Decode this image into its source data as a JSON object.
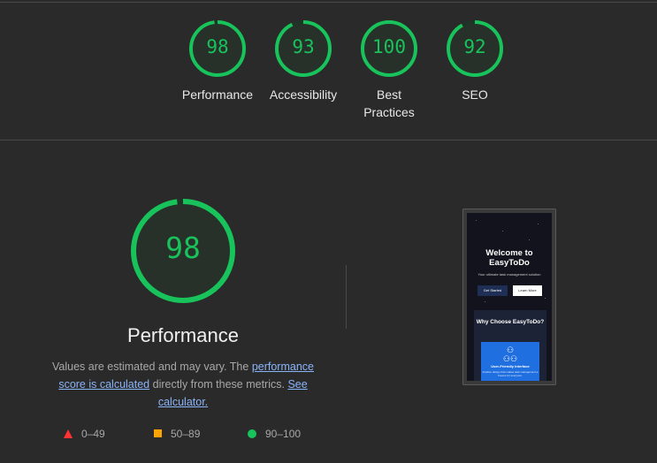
{
  "scores": [
    {
      "value": "98",
      "label": "Performance",
      "fraction": 0.98
    },
    {
      "value": "93",
      "label": "Accessibility",
      "fraction": 0.93
    },
    {
      "value": "100",
      "label": "Best Practices",
      "fraction": 1.0
    },
    {
      "value": "92",
      "label": "SEO",
      "fraction": 0.92
    }
  ],
  "main": {
    "score": "98",
    "fraction": 0.98,
    "title": "Performance",
    "desc_prefix": "Values are estimated and may vary. The ",
    "link_score": "performance score is calculated",
    "desc_middle": " directly from these metrics. ",
    "link_calc": "See calculator.",
    "legend": {
      "fail": "0–49",
      "average": "50–89",
      "pass": "90–100"
    }
  },
  "colors": {
    "pass": "#19c35b",
    "average": "#ffa400",
    "fail": "#ff3333",
    "background": "#2a2a2a"
  },
  "screenshot": {
    "hero_title": "Welcome to EasyToDo",
    "hero_sub": "Your ultimate task management solution",
    "btn_start": "Get Started",
    "btn_learn": "Learn More",
    "why_title": "Why Choose EasyToDo?",
    "card_title": "User-Friendly Interface",
    "card_text": "Intuitive design that makes task management a breeze for everyone."
  }
}
